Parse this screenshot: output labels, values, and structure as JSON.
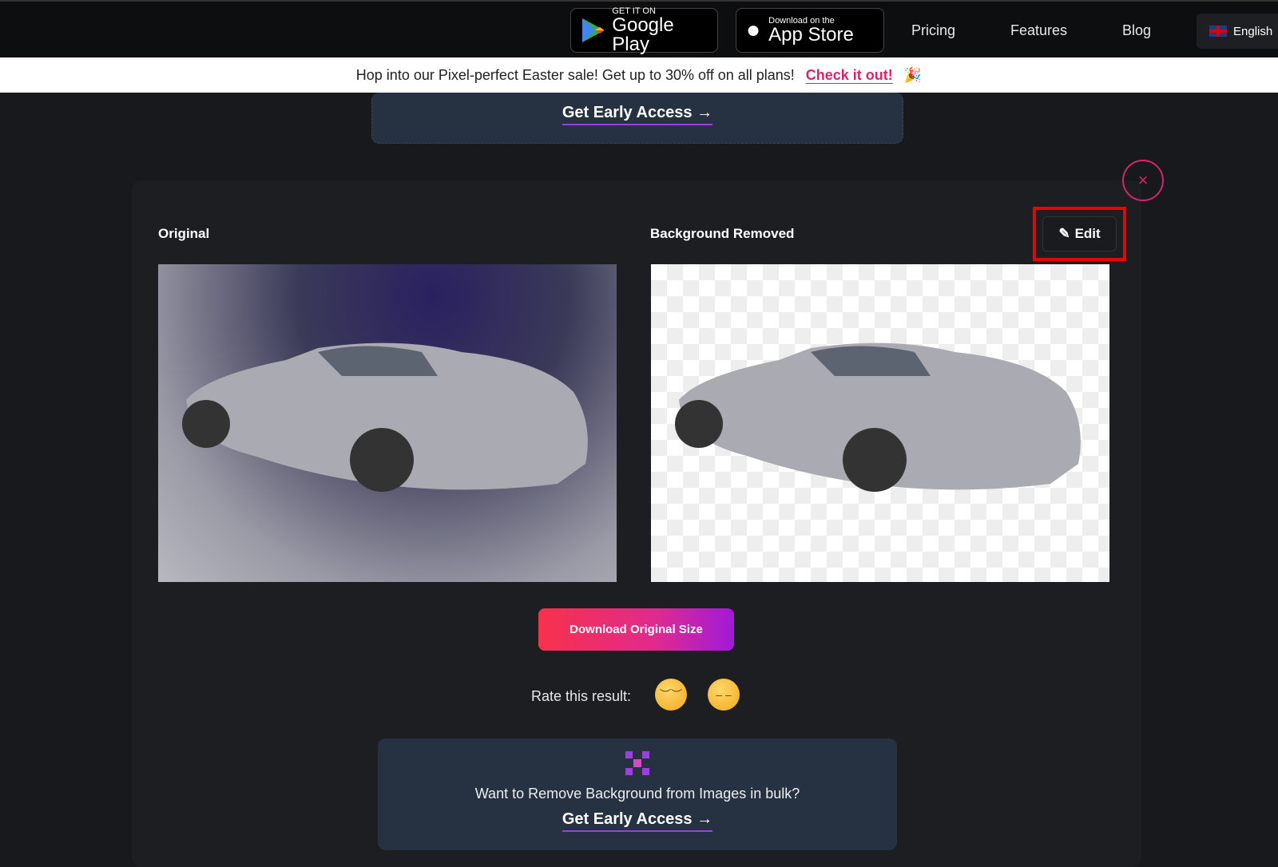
{
  "header": {
    "google_play": {
      "small": "GET IT ON",
      "big": "Google Play"
    },
    "app_store": {
      "small": "Download on the",
      "big": "App Store"
    },
    "nav": [
      "Pricing",
      "Features",
      "Blog"
    ],
    "language": "English"
  },
  "banner": {
    "text": "Hop into our Pixel-perfect Easter sale! Get up to 30% off on all plans!",
    "link": "Check it out!",
    "emoji": "🎉"
  },
  "top_promo": {
    "cta": "Get Early Access →"
  },
  "result": {
    "original_label": "Original",
    "removed_label": "Background Removed",
    "edit_label": "Edit",
    "close": "×",
    "download_label": "Download Original Size",
    "rate_label": "Rate this result:"
  },
  "bottom_promo": {
    "text": "Want to Remove Background from Images in bulk?",
    "cta": "Get Early Access →"
  },
  "colors": {
    "accent": "#d6246e",
    "gradient_start": "#f8314b",
    "gradient_end": "#a11ad8",
    "highlight": "#ee0000"
  }
}
